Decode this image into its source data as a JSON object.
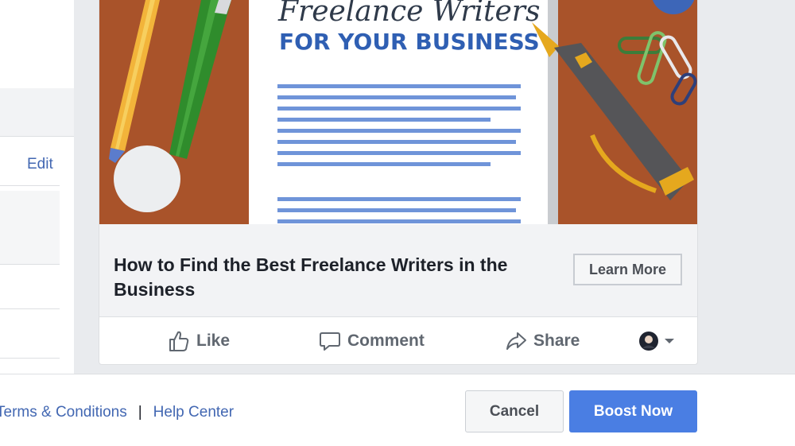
{
  "sidebar": {
    "edit_label": "Edit"
  },
  "post": {
    "image": {
      "heading_script": "Freelance Writers",
      "heading_bold": "FOR YOUR BUSINESS"
    },
    "link_title": "How to Find the Best Freelance Writers in the Business",
    "cta_label": "Learn More",
    "actions": {
      "like": "Like",
      "comment": "Comment",
      "share": "Share"
    }
  },
  "footer": {
    "links": [
      "Terms & Conditions",
      "Help Center"
    ],
    "separator": "|",
    "cancel_label": "Cancel",
    "boost_label": "Boost Now"
  },
  "colors": {
    "brand_blue": "#4a7ee3",
    "link_blue": "#4267b2",
    "desk_brown": "#a9532a"
  },
  "icons": [
    "like-thumb-icon",
    "comment-bubble-icon",
    "share-arrow-icon",
    "profile-avatar-icon",
    "caret-down-icon"
  ]
}
